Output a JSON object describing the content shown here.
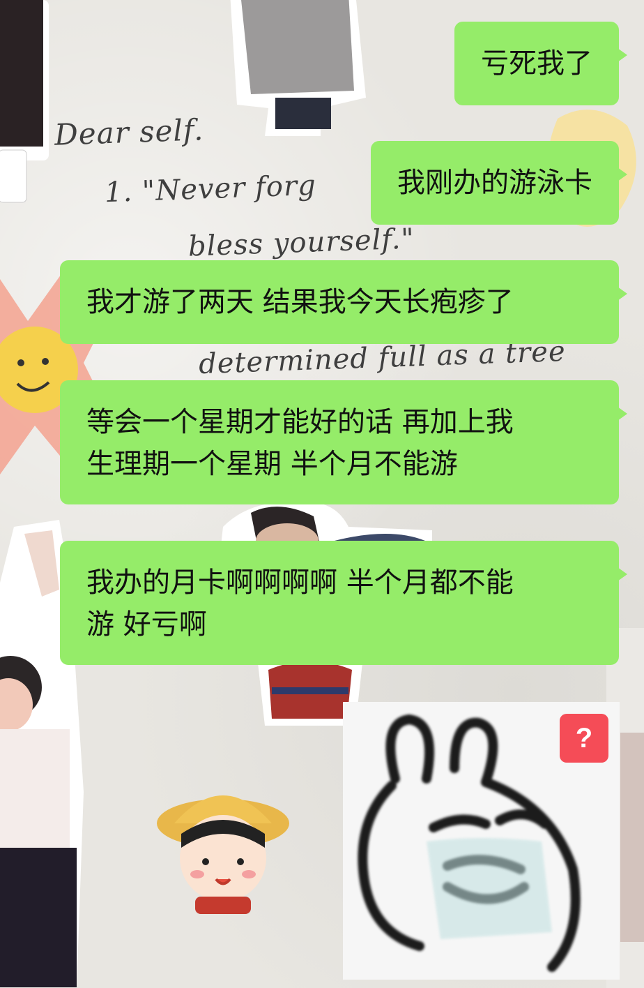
{
  "chat": {
    "messages": [
      {
        "type": "text",
        "text": "亏死我了"
      },
      {
        "type": "text",
        "text": "我刚办的游泳卡"
      },
      {
        "type": "text",
        "text": "我才游了两天 结果我今天长疱疹了"
      },
      {
        "type": "text",
        "lines": [
          "等会一个星期才能好的话 再加上我",
          "生理期一个星期 半个月不能游"
        ]
      },
      {
        "type": "text",
        "lines": [
          "我办的月卡啊啊啊啊 半个月都不能",
          "游 好亏啊"
        ]
      },
      {
        "type": "sticker",
        "icon": "crying-rabbit-sticker",
        "badge": "?"
      }
    ]
  },
  "background": {
    "handwriting": [
      "Dear self.",
      "1. \"Never forg",
      "bless yourself.\"",
      "determined full as a tree"
    ]
  },
  "colors": {
    "bubble": "#95ec69",
    "badge": "#f54c57"
  }
}
